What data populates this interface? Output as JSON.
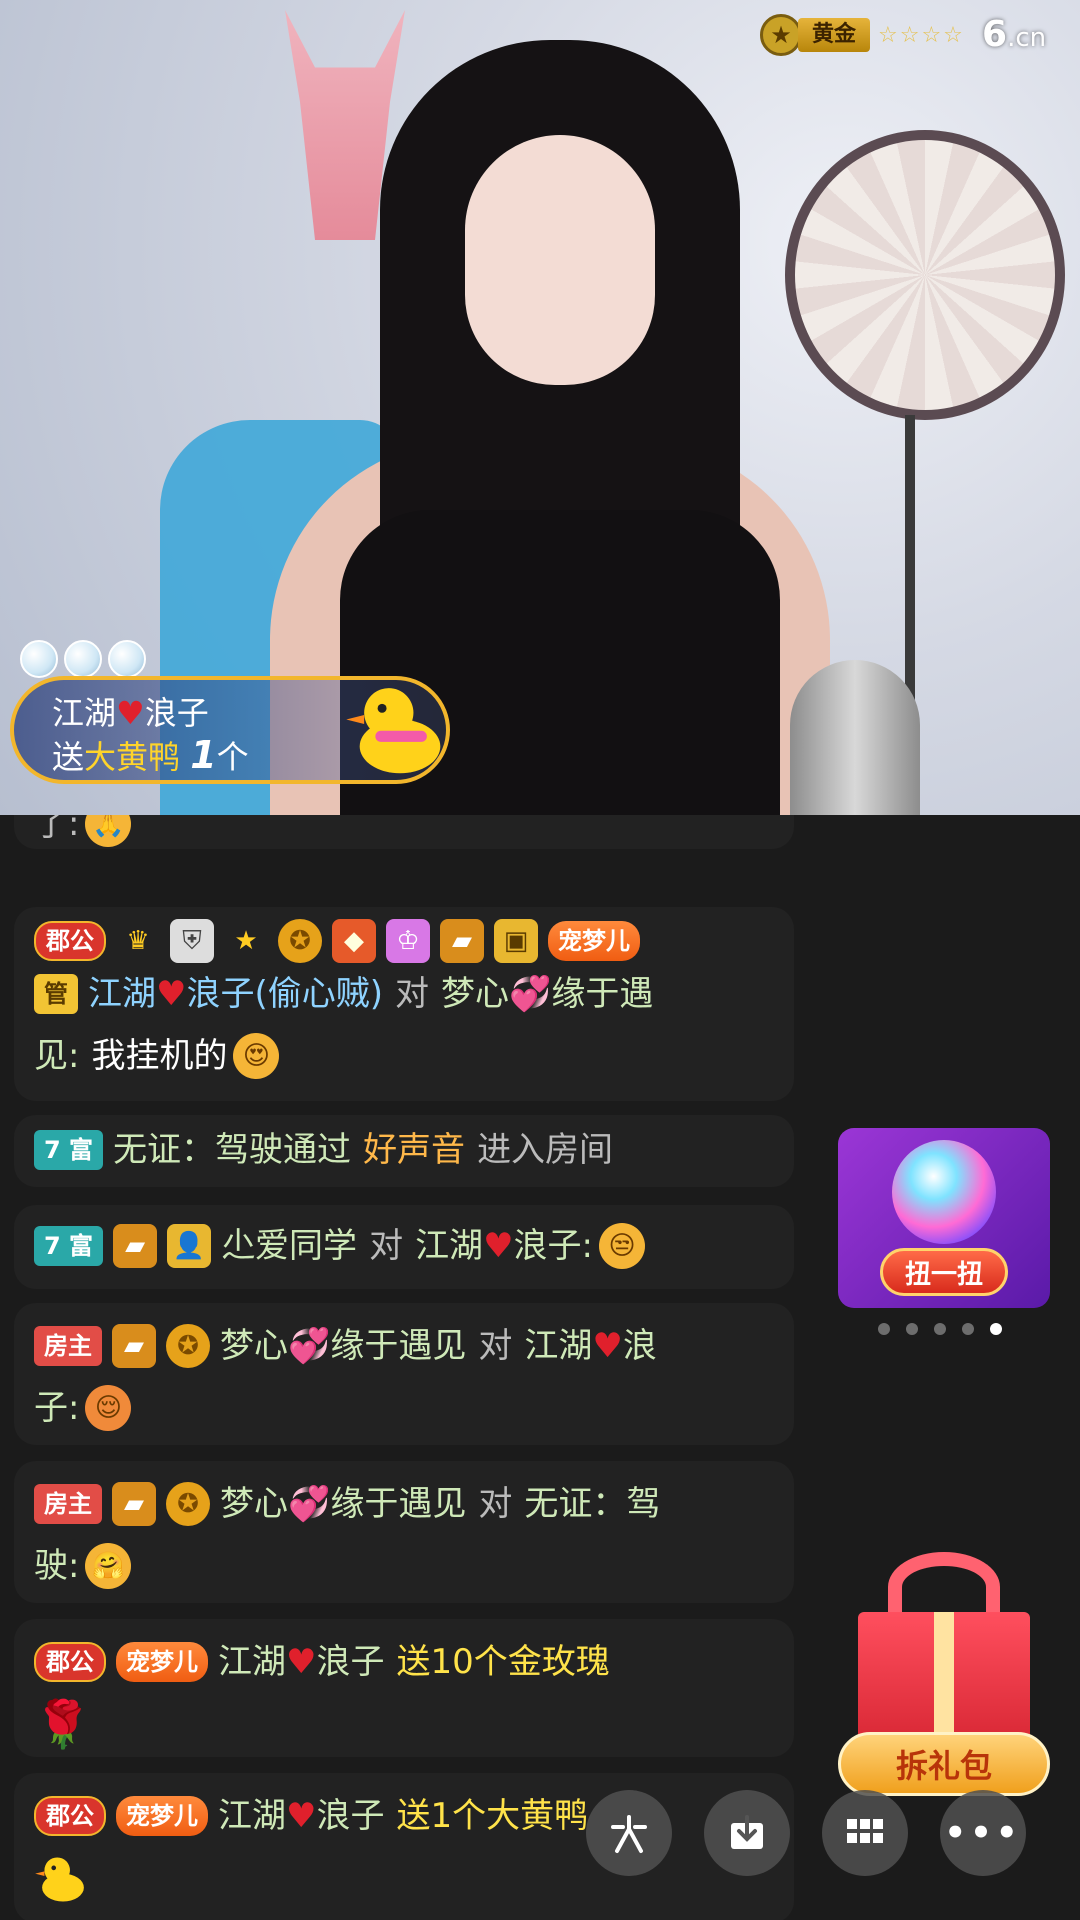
{
  "video": {
    "level_badge": "黄金",
    "stars": "☆☆☆☆",
    "site_logo": "6",
    "site_logo_suffix": ".cn"
  },
  "gift_notification": {
    "sender_left": "江湖",
    "sender_right": "浪子",
    "sent_prefix": "送",
    "gift_name": "大黄鸭",
    "count": "1",
    "unit": "个"
  },
  "chat": {
    "top_partial": "了:",
    "messages": [
      {
        "badge": "郡公",
        "pet_badge": "宠梦儿",
        "role_badge": "管",
        "user_a": "江湖",
        "user_a_tail": "浪子(偷心贼)",
        "verb": "对",
        "user_b": "梦心",
        "user_b_tail": "缘于遇",
        "text_line2_prefix": "见:",
        "text": "我挂机的"
      },
      {
        "badge": "7 富",
        "user": "无证：驾驶通过",
        "highlight": "好声音",
        "text": "进入房间"
      },
      {
        "badge": "7 富",
        "user": "尐爱同学",
        "verb": "对",
        "target_a": "江湖",
        "target_b": "浪子:"
      },
      {
        "badge": "房主",
        "user_a": "梦心",
        "user_a_tail": "缘于遇见",
        "verb": "对",
        "target_a": "江湖",
        "target_b": "浪",
        "line2": "子:"
      },
      {
        "badge": "房主",
        "user_a": "梦心",
        "user_a_tail": "缘于遇见",
        "verb": "对",
        "target": "无证：驾",
        "line2": "驶:"
      },
      {
        "badge": "郡公",
        "pet_badge": "宠梦儿",
        "user_a": "江湖",
        "user_b": "浪子",
        "gift_text": "送10个金玫瑰"
      },
      {
        "badge": "郡公",
        "pet_badge": "宠梦儿",
        "user_a": "江湖",
        "user_b": "浪子",
        "gift_text": "送1个大黄鸭"
      }
    ]
  },
  "side": {
    "gacha_label": "扭一扭",
    "giftpack_label": "拆礼包",
    "carousel_active_index": 4,
    "carousel_count": 5
  },
  "colors": {
    "background": "#1b1b1b",
    "bubble": "#222222",
    "username_blue": "#8fd3ff",
    "gift_yellow": "#ffe34a",
    "highlight_orange": "#ffb84a"
  },
  "icons": [
    "chat-icon",
    "download-icon",
    "apps-icon",
    "more-icon"
  ]
}
